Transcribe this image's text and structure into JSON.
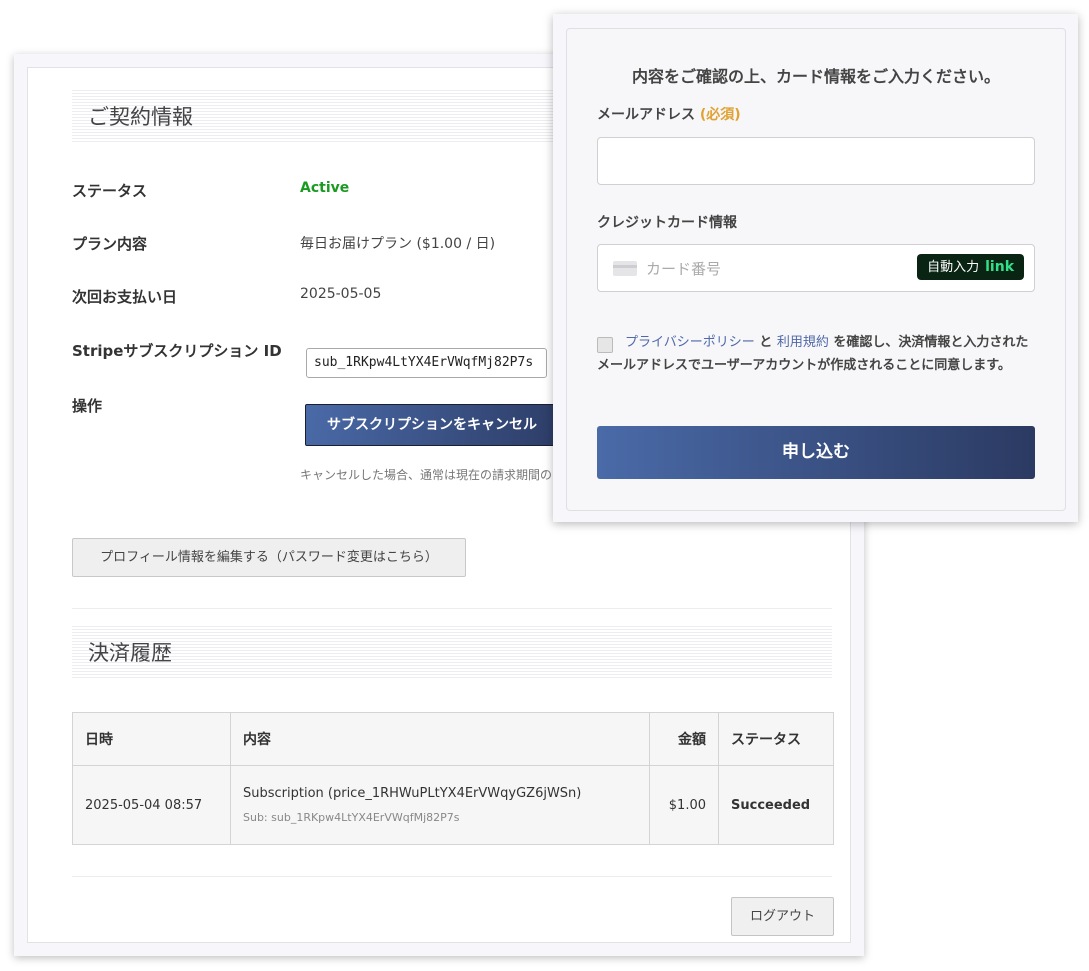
{
  "contract": {
    "heading": "ご契約情報",
    "status_label": "ステータス",
    "status_value": "Active",
    "plan_label": "プラン内容",
    "plan_value": "毎日お届けプラン ($1.00 / 日)",
    "next_payment_label": "次回お支払い日",
    "next_payment_value": "2025-05-05",
    "sub_id_label": "Stripeサブスクリプション ID",
    "sub_id_value": "sub_1RKpw4LtYX4ErVWqfMj82P7s",
    "action_label": "操作",
    "cancel_button": "サブスクリプションをキャンセル",
    "cancel_note": "キャンセルした場合、通常は現在の請求期間の",
    "profile_button": "プロフィール情報を編集する（パスワード変更はこちら）"
  },
  "history": {
    "heading": "決済履歴",
    "columns": [
      "日時",
      "内容",
      "金額",
      "ステータス"
    ],
    "rows": [
      {
        "datetime": "2025-05-04 08:57",
        "description": "Subscription (price_1RHWuPLtYX4ErVWqyGZ6jWSn)",
        "sub": "Sub: sub_1RKpw4LtYX4ErVWqfMj82P7s",
        "amount": "$1.00",
        "status": "Succeeded"
      }
    ]
  },
  "logout_button": "ログアウト",
  "checkout": {
    "title": "内容をご確認の上、カード情報をご入力ください。",
    "email_label": "メールアドレス",
    "email_required": "(必須)",
    "email_value": "",
    "card_label": "クレジットカード情報",
    "card_placeholder": "カード番号",
    "autofill_label": "自動入力",
    "autofill_brand": "link",
    "privacy_link": "プライバシーポリシー",
    "and_text": "と",
    "terms_link": "利用規約",
    "consent_text": "を確認し、決済情報と入力されたメールアドレスでユーザーアカウントが作成されることに同意します。",
    "submit_button": "申し込む"
  },
  "colors": {
    "accent": "#3e5a96",
    "active": "#1a9a20",
    "required": "#e0a232",
    "link_green": "#33e08a"
  },
  "icons": [
    "card-icon"
  ]
}
